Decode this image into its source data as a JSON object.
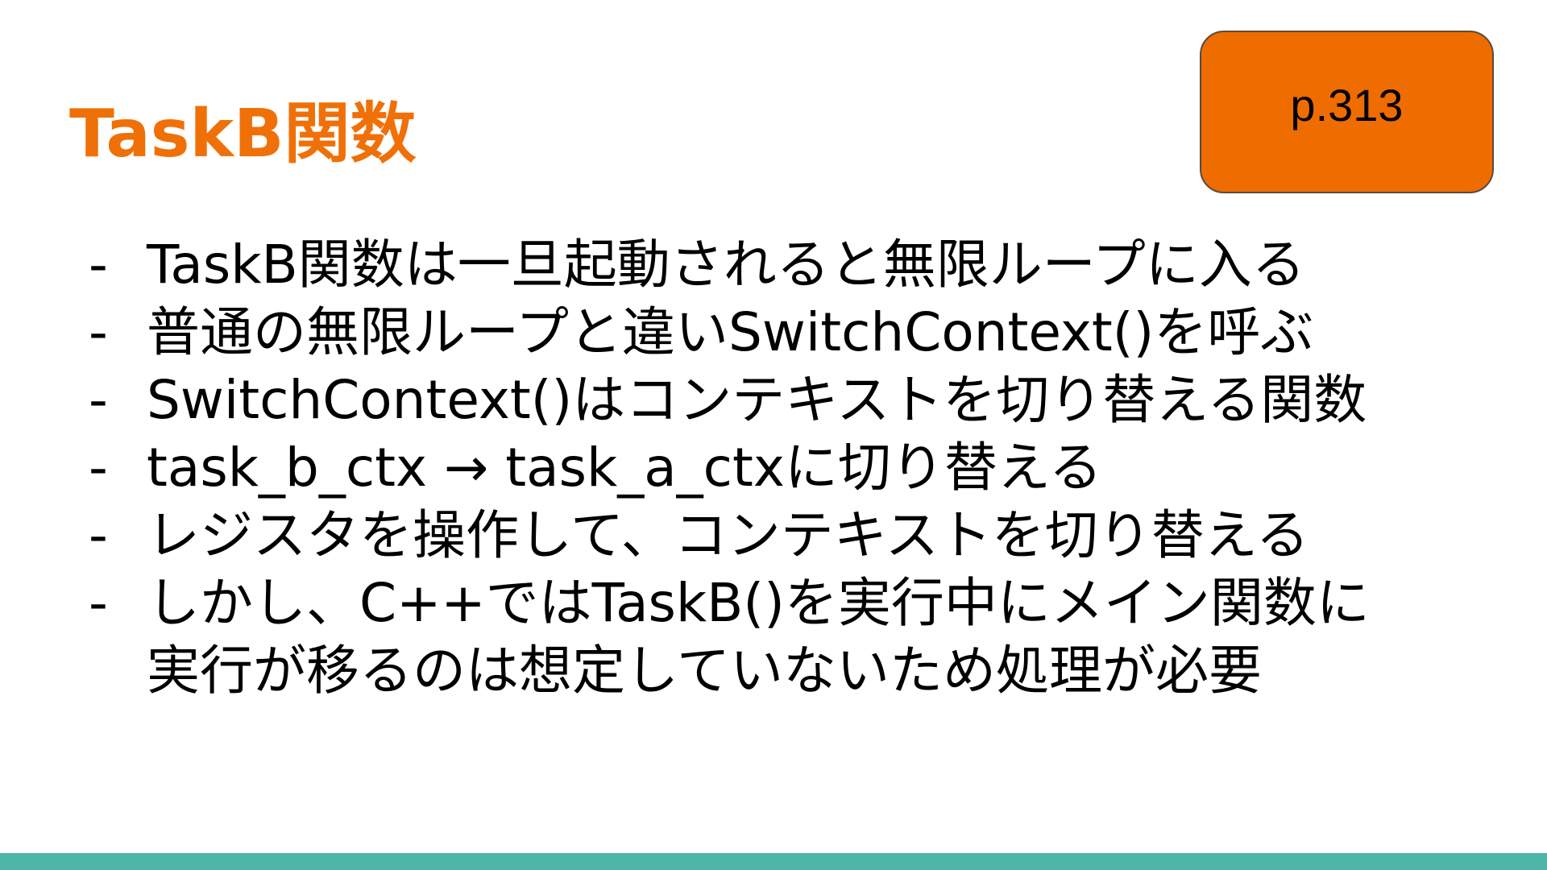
{
  "slide": {
    "title": "TaskB関数",
    "page_badge": "p.313",
    "bullet_marker": "-",
    "bullets": [
      "TaskB関数は一旦起動されると無限ループに入る",
      "普通の無限ループと違いSwitchContext()を呼ぶ",
      "SwitchContext()はコンテキストを切り替える関数",
      "task_b_ctx → task_a_ctxに切り替える",
      "レジスタを操作して、コンテキストを切り替える",
      "しかし、C++ではTaskB()を実行中にメイン関数に\n実行が移るのは想定していないため処理が必要"
    ]
  },
  "colors": {
    "title": "#f07008",
    "badge_fill": "#ef6c00",
    "footer": "#4fb5a6"
  }
}
